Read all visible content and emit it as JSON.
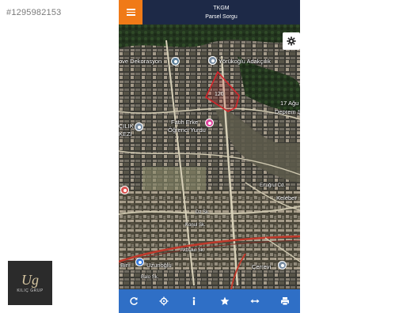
{
  "listing_id": "#1295982153",
  "watermark": {
    "mark": "Ug",
    "sub": "KILIÇ GRUP"
  },
  "header": {
    "title": "TKGM",
    "subtitle": "Parsel Sorgu"
  },
  "map": {
    "parcel_number": "120",
    "pois": [
      {
        "label": "ove Dekorasyon"
      },
      {
        "label": "Yörükoğlu Adakçılık"
      },
      {
        "label": "17 Ağu"
      },
      {
        "label": "Deprem Şe"
      },
      {
        "label": "Fatih Erke"
      },
      {
        "label": "Öğrenci Yurdu"
      },
      {
        "label": "ÇILIK"
      },
      {
        "label": "KEZİ"
      },
      {
        "label": "Keleber"
      },
      {
        "label": "Binı"
      },
      {
        "label": "Uzunoğlu"
      },
      {
        "label": "Çerrevi"
      }
    ],
    "streets": [
      {
        "label": "Konul Sk."
      },
      {
        "label": "Akbulut Sk."
      },
      {
        "label": "Balo Sk."
      },
      {
        "label": "Dz Sk."
      },
      {
        "label": "Ertuğrul Cd."
      }
    ]
  },
  "toolbar": {
    "refresh_icon": "refresh-icon",
    "locate_icon": "crosshair-icon",
    "info_icon": "info-icon",
    "favorite_icon": "star-icon",
    "measure_icon": "arrows-horizontal-icon",
    "print_icon": "print-icon"
  },
  "colors": {
    "topbar": "#1d2947",
    "menu": "#f07a17",
    "toolbar": "#2f6fc6",
    "parcel": "#d8252b"
  }
}
